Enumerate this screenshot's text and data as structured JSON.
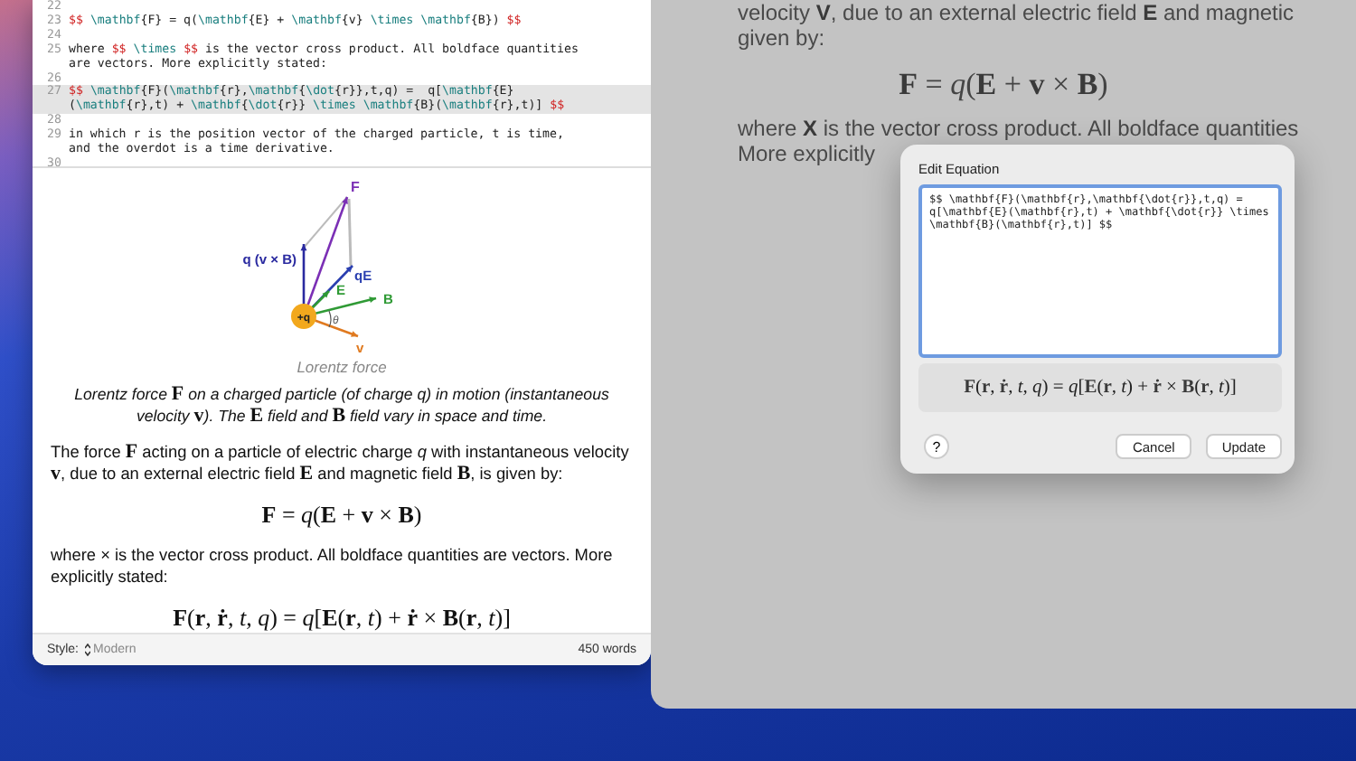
{
  "editor": {
    "lines": [
      {
        "number": "22",
        "selected": false
      },
      {
        "number": "23",
        "selected": false,
        "text": [
          "$$ \\mathbf{F} = q(\\mathbf{E} + \\mathbf{v} \\times \\mathbf{B}) $$"
        ]
      },
      {
        "number": "24",
        "selected": false
      },
      {
        "number": "25",
        "selected": false,
        "text": [
          "where $$ \\times $$ is the vector cross product. All boldface quantities",
          "are vectors. More explicitly stated:"
        ]
      },
      {
        "number": "26",
        "selected": false
      },
      {
        "number": "27",
        "selected": true,
        "text": [
          "$$ \\mathbf{F}(\\mathbf{r},\\mathbf{\\dot{r}},t,q) =  q[\\mathbf{E}",
          "(\\mathbf{r},t) + \\mathbf{\\dot{r}} \\times \\mathbf{B}(\\mathbf{r},t)] $$"
        ]
      },
      {
        "number": "28",
        "selected": false
      },
      {
        "number": "29",
        "selected": false,
        "text": [
          "in which r is the position vector of the charged particle, t is time,",
          "and the overdot is a time derivative."
        ]
      },
      {
        "number": "30",
        "selected": false
      }
    ]
  },
  "preview": {
    "figure": {
      "labels": {
        "force": "F",
        "magnetic": "q (v × B)",
        "electric_force": "qE",
        "field_e": "E",
        "field_b": "B",
        "angle": "θ",
        "velocity": "v",
        "charge": "+q"
      },
      "title": "Lorentz force"
    },
    "caption": "Lorentz force **F** on a charged particle (of charge q) in motion (instantaneous velocity **v**). The **E** field and **B** field vary in space and time.",
    "paragraph_1": "The force **F** acting on a particle of electric charge *q* with instantaneous velocity **v**, due to an external electric field **E** and magnetic field **B**, is given by:",
    "equation_1": "**F** = *q*(**E** + **v** × **B**)",
    "paragraph_2": "where × is the vector cross product. All boldface quantities are vectors. More explicitly stated:",
    "equation_2": "**F**(**r**, **ṙ**, *t*, *q*) = *q*[**E**(**r**, *t*) + **ṙ** × **B**(**r**, *t*)]"
  },
  "status_bar": {
    "style_label": "Style:",
    "style_value": "Modern",
    "word_count": "450 words"
  },
  "background_document": {
    "lines": [
      "velocity **V**, due to an external electric field **E** and magnetic",
      "given by:"
    ],
    "equation": "**F** = *q*(**E** + **v** × **B**)",
    "line_after": "where **X** is the vector cross product. All boldface quantities",
    "line_covered": "More explicitly"
  },
  "dialog": {
    "title": "Edit Equation",
    "value": "$$ \\mathbf{F}(\\mathbf{r},\\mathbf{\\dot{r}},t,q) = q[\\mathbf{E}(\\mathbf{r},t) + \\mathbf{\\dot{r}} \\times \\mathbf{B}(\\mathbf{r},t)] $$",
    "preview": "**F**(**r**, **ṙ**, *t*, *q*) = *q*[**E**(**r**, *t*) + **ṙ** × **B**(**r**, *t*)]",
    "help": "?",
    "buttons": [
      "Cancel",
      "Update"
    ]
  }
}
